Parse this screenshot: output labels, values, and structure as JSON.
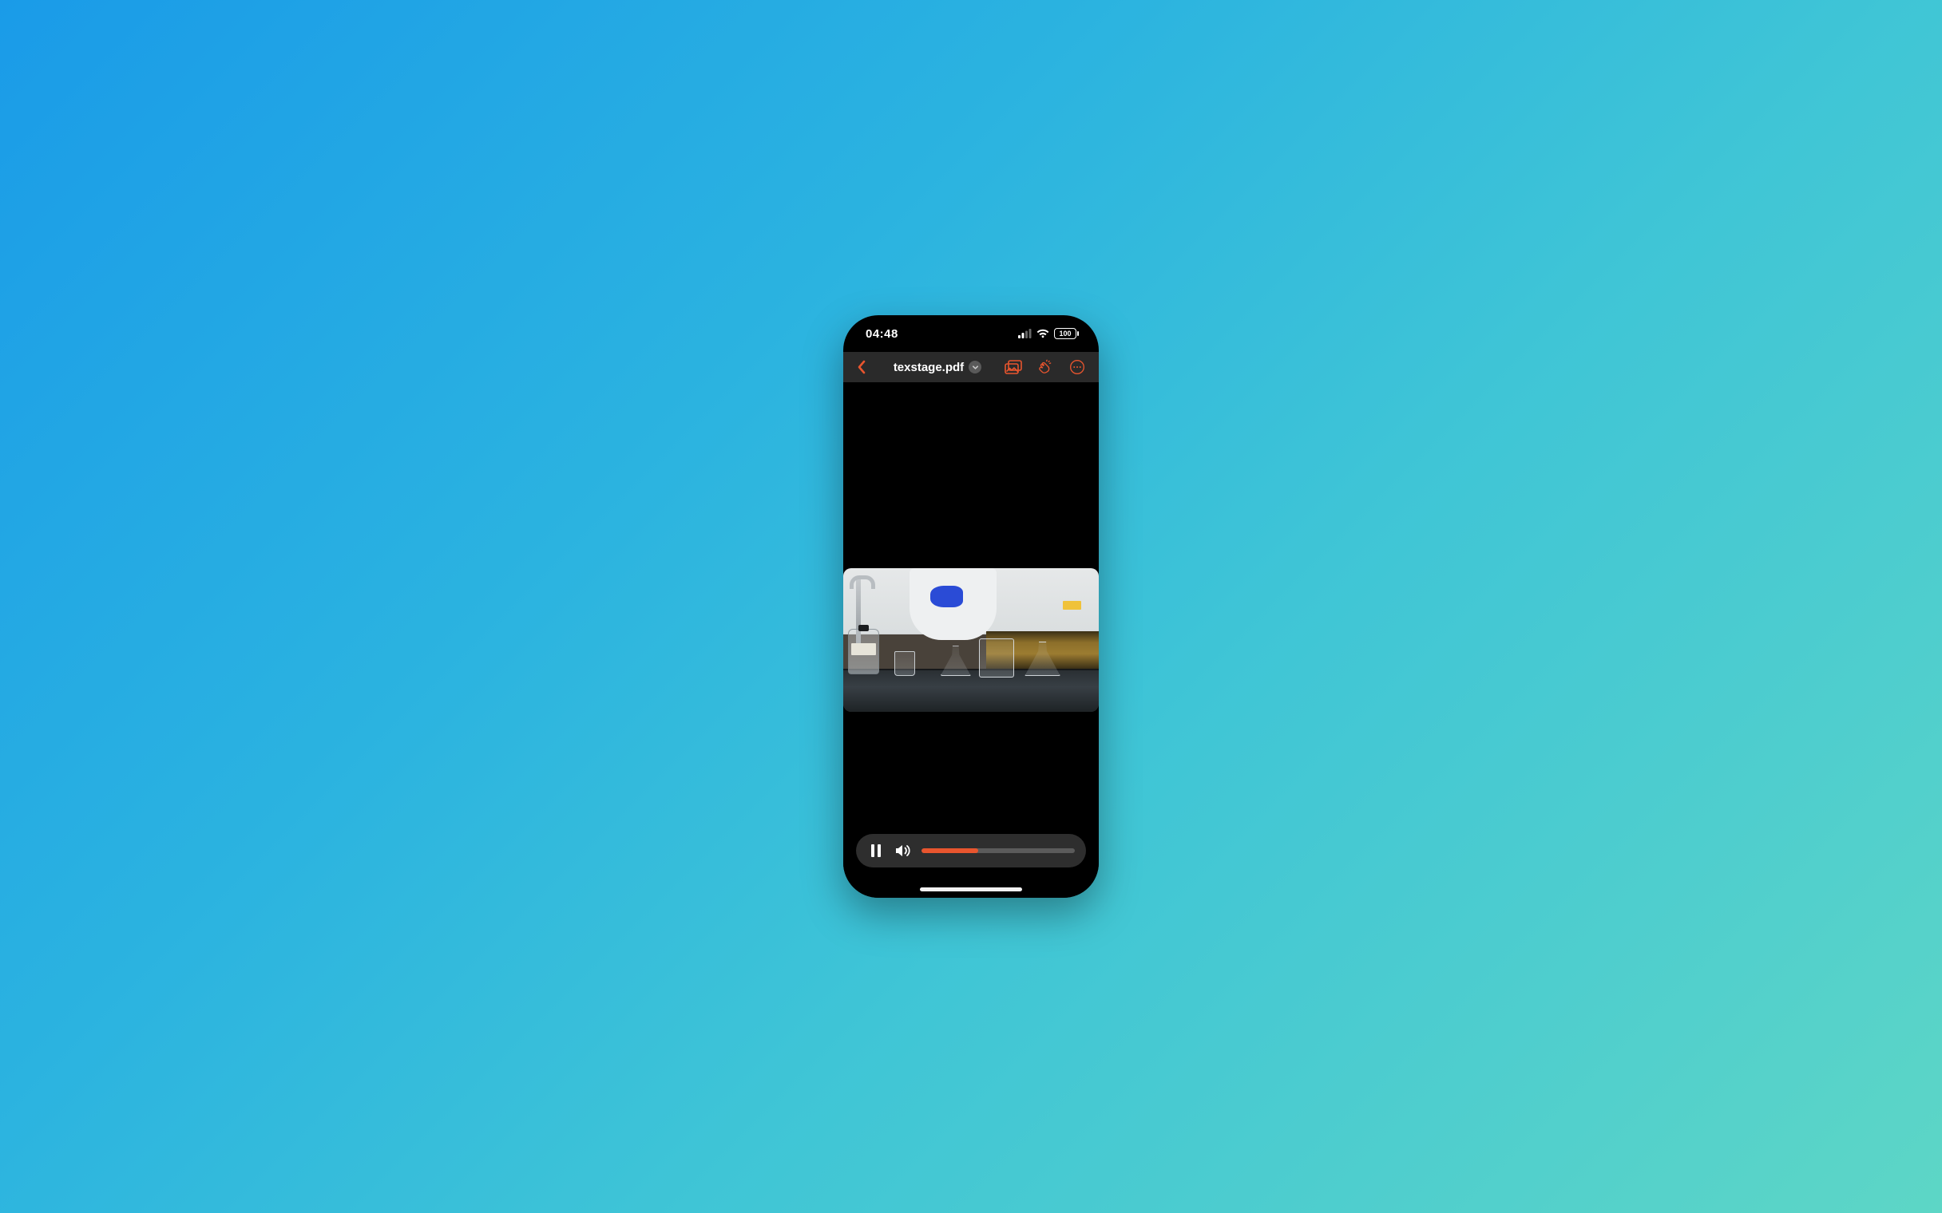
{
  "status": {
    "time": "04:48",
    "cell_bars": 2,
    "wifi": true,
    "battery_percent": 100,
    "battery_label": "100"
  },
  "nav": {
    "title": "texstage.pdf"
  },
  "accent_color": "#e8552e",
  "player": {
    "playing": true,
    "progress_percent": 37
  },
  "icons": {
    "back": "back-chevron-icon",
    "title_dropdown": "chevron-down-icon",
    "gallery": "gallery-icon",
    "clap": "clap-icon",
    "more": "more-circle-icon",
    "pause": "pause-icon",
    "volume": "volume-icon"
  },
  "slide": {
    "description": "Laboratory scene: person in white lab coat with blue glove holding a glass rod over beakers and Erlenmeyer flasks on a dark lab bench, with a reagent bottle and faucet on the left and wooden cabinet backdrop on the right."
  }
}
